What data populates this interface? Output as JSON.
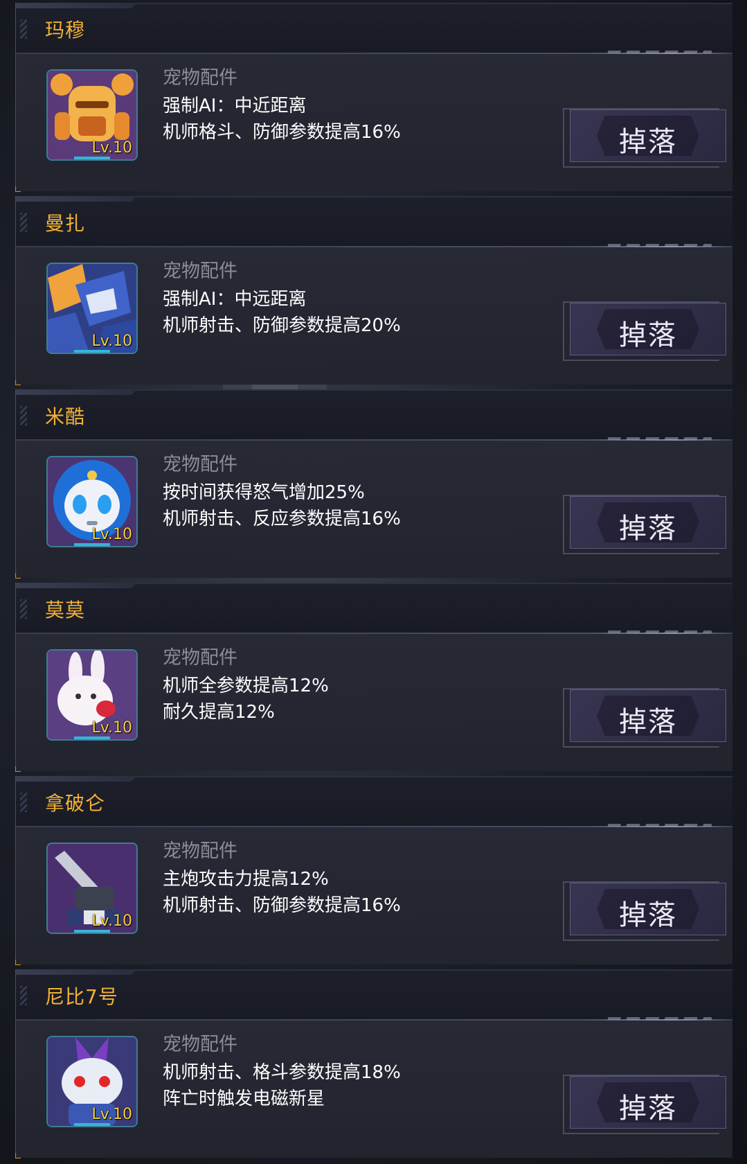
{
  "pets": [
    {
      "name": "玛穆",
      "category": "宠物配件",
      "lines": [
        "强制AI：中近距离",
        "机师格斗、防御参数提高16%"
      ],
      "level": "Lv.10",
      "button": "掉落",
      "icon": "golden-robot-portrait-icon"
    },
    {
      "name": "曼扎",
      "category": "宠物配件",
      "lines": [
        "强制AI：中远距离",
        "机师射击、防御参数提高20%"
      ],
      "level": "Lv.10",
      "button": "掉落",
      "icon": "blue-mech-portrait-icon"
    },
    {
      "name": "米酷",
      "category": "宠物配件",
      "lines": [
        "按时间获得怒气增加25%",
        "机师射击、反应参数提高16%"
      ],
      "level": "Lv.10",
      "button": "掉落",
      "icon": "blue-hooded-robot-portrait-icon"
    },
    {
      "name": "莫莫",
      "category": "宠物配件",
      "lines": [
        "机师全参数提高12%",
        "耐久提高12%"
      ],
      "level": "Lv.10",
      "button": "掉落",
      "icon": "white-rabbit-portrait-icon"
    },
    {
      "name": "拿破仑",
      "category": "宠物配件",
      "lines": [
        "主炮攻击力提高12%",
        "机师射击、防御参数提高16%"
      ],
      "level": "Lv.10",
      "button": "掉落",
      "icon": "cannon-robot-portrait-icon"
    },
    {
      "name": "尼比7号",
      "category": "宠物配件",
      "lines": [
        "机师射击、格斗参数提高18%",
        "阵亡时触发电磁新星"
      ],
      "level": "Lv.10",
      "button": "掉落",
      "icon": "red-eyed-robot-portrait-icon"
    }
  ],
  "colors": {
    "name": "#f2b234",
    "level": "#f5d13a",
    "category": "#8b8d96",
    "description": "#ffffff"
  }
}
